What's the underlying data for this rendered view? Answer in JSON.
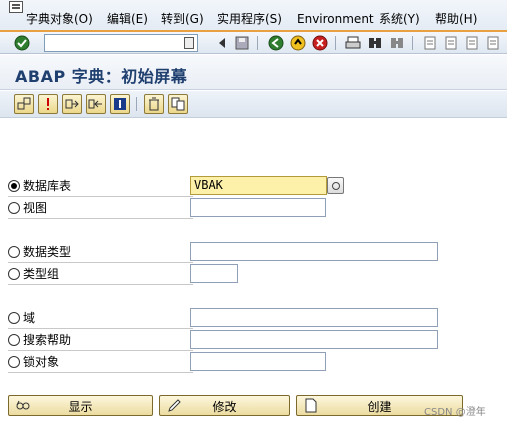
{
  "menubar": {
    "items": [
      {
        "label": "字典对象(O)"
      },
      {
        "label": "编辑(E)"
      },
      {
        "label": "转到(G)"
      },
      {
        "label": "实用程序(S)"
      },
      {
        "label": "Environment"
      },
      {
        "label": "系统(Y)"
      },
      {
        "label": "帮助(H)"
      }
    ]
  },
  "toolbar": {
    "command_field_value": "",
    "icons": [
      "enter-icon",
      "back-icon",
      "exit-icon",
      "cancel-icon",
      "print-icon",
      "find-icon",
      "find-next-icon",
      "first-page-icon",
      "previous-page-icon",
      "next-page-icon",
      "last-page-icon",
      "save-icon"
    ]
  },
  "header": {
    "title": "ABAP 字典：初始屏幕"
  },
  "app_toolbar": {
    "icons": [
      "other-object-icon",
      "check-icon",
      "activate-icon",
      "where-used-icon",
      "display-object-list-icon",
      "delete-icon",
      "copy-icon"
    ]
  },
  "form": {
    "database_table": {
      "label": "数据库表",
      "value": "VBAK",
      "selected": true
    },
    "view": {
      "label": "视图",
      "value": ""
    },
    "data_type": {
      "label": "数据类型",
      "value": ""
    },
    "type_group": {
      "label": "类型组",
      "value": ""
    },
    "domain": {
      "label": "域",
      "value": ""
    },
    "search_help": {
      "label": "搜索帮助",
      "value": ""
    },
    "lock_object": {
      "label": "锁对象",
      "value": ""
    }
  },
  "buttons": {
    "display": {
      "label": "显示"
    },
    "change": {
      "label": "修改"
    },
    "create": {
      "label": "创建"
    }
  },
  "watermark": {
    "text": "CSDN @澄年"
  },
  "colors": {
    "title": "#1f3f6f",
    "required_field": "#fdf0a8",
    "menu_accent_line": "#e8a040",
    "button_face": "#ecdca0"
  }
}
